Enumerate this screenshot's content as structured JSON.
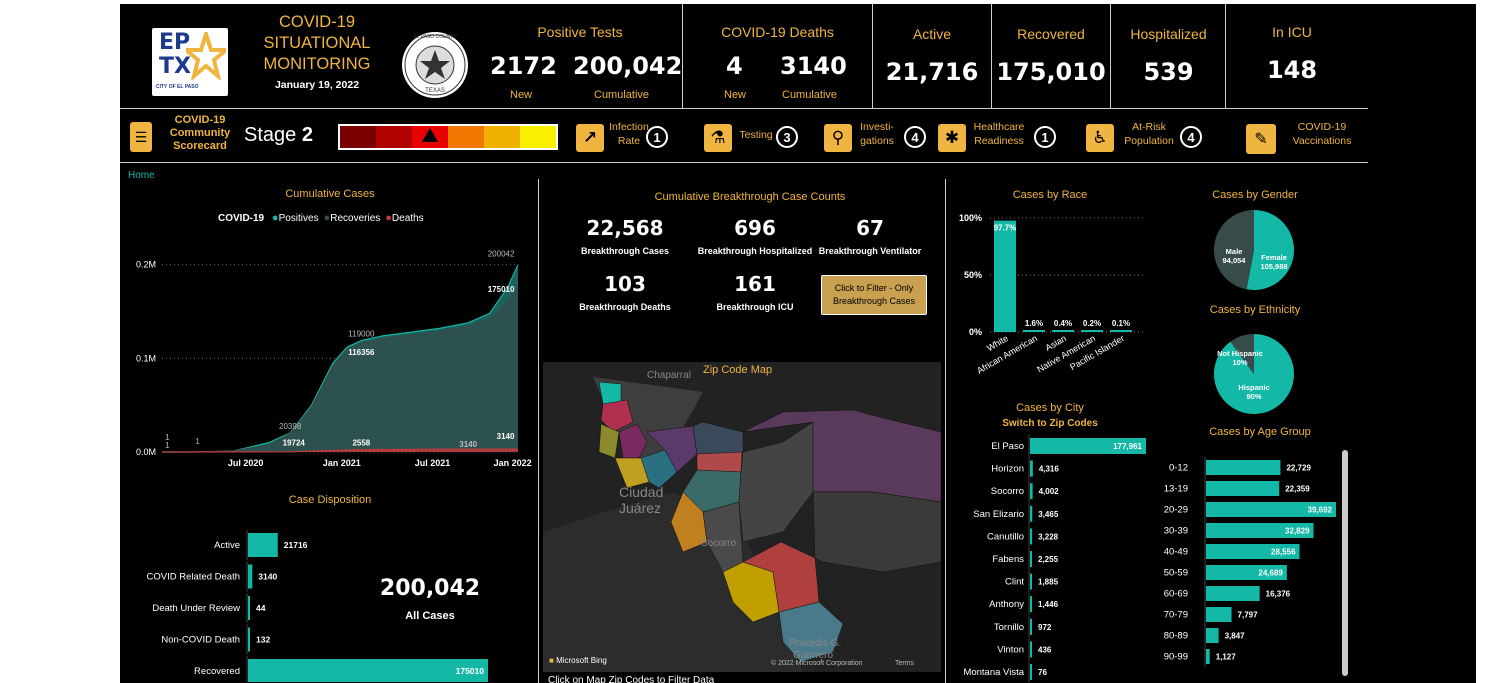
{
  "header": {
    "logo_ep": "EP",
    "logo_tx": "TX",
    "logo_sub": "CITY OF EL PASO",
    "title_line1": "COVID-19",
    "title_line2": "SITUATIONAL",
    "title_line3": "MONITORING",
    "date": "January 19, 2022",
    "seal_top": "EL PASO COUNTY",
    "seal_bottom": "TEXAS"
  },
  "kpis": {
    "positive_title": "Positive Tests",
    "positive_new": "2172",
    "positive_cum": "200,042",
    "new_label": "New",
    "cum_label": "Cumulative",
    "deaths_title": "COVID-19 Deaths",
    "deaths_new": "4",
    "deaths_cum": "3140",
    "active_title": "Active",
    "active_val": "21,716",
    "recovered_title": "Recovered",
    "recovered_val": "175,010",
    "hosp_title": "Hospitalized",
    "hosp_val": "539",
    "icu_title": "In ICU",
    "icu_val": "148"
  },
  "scorecard": {
    "label_line1": "COVID-19",
    "label_line2": "Community",
    "label_line3": "Scorecard",
    "stage_label": "Stage",
    "stage_num": "2",
    "items": [
      {
        "line1": "Infection",
        "line2": "Rate",
        "num": "1",
        "icon": "chart-icon"
      },
      {
        "line1": "Testing",
        "line2": "",
        "num": "3",
        "icon": "flask-icon"
      },
      {
        "line1": "Investi-",
        "line2": "gations",
        "num": "4",
        "icon": "magnifier-icon"
      },
      {
        "line1": "Healthcare",
        "line2": "Readiness",
        "num": "1",
        "icon": "medical-icon"
      },
      {
        "line1": "At-Risk",
        "line2": "Population",
        "num": "4",
        "icon": "wheelchair-icon"
      }
    ],
    "vacc_line1": "COVID-19",
    "vacc_line2": "Vaccinations",
    "level_colors": [
      "#7a0000",
      "#b00000",
      "#e80000",
      "#f07800",
      "#f0b000",
      "#f8f000"
    ]
  },
  "home_link": "Home",
  "cumulative": {
    "title": "Cumulative Cases",
    "legend_title": "COVID-19",
    "legend": [
      {
        "name": "Positives",
        "color": "#14b8a6"
      },
      {
        "name": "Recoveries",
        "color": "#374c4a"
      },
      {
        "name": "Deaths",
        "color": "#c0393b"
      }
    ]
  },
  "disposition": {
    "title": "Case Disposition",
    "total": "200,042",
    "total_label": "All Cases"
  },
  "breakthrough": {
    "title": "Cumulative Breakthrough Case Counts",
    "items": [
      {
        "value": "22,568",
        "label": "Breakthrough Cases"
      },
      {
        "value": "696",
        "label": "Breakthrough Hospitalized"
      },
      {
        "value": "67",
        "label": "Breakthrough Ventilator"
      },
      {
        "value": "103",
        "label": "Breakthrough Deaths"
      },
      {
        "value": "161",
        "label": "Breakthrough ICU"
      }
    ],
    "filter_line1": "Click to Filter - Only",
    "filter_line2": "Breakthrough Cases"
  },
  "map": {
    "title": "Zip Code Map",
    "chaparral": "Chaparral",
    "ciudad": "Ciudad",
    "juarez": "Juárez",
    "socorro": "Socorro",
    "praxedis1": "Praxedis G.",
    "praxedis2": "Guerrero",
    "bing": "Microsoft Bing",
    "copyright": "© 2022 Microsoft Corporation",
    "terms": "Terms",
    "footer": "Click on Map Zip Codes  to Filter Data"
  },
  "city": {
    "title": "Cases  by City",
    "switch": "Switch to Zip Codes"
  },
  "gender": {
    "title": "Cases by Gender"
  },
  "ethnicity": {
    "title": "Cases by Ethnicity"
  },
  "age_title": "Cases  by Age Group",
  "chart_data": [
    {
      "type": "area",
      "title": "Cumulative Cases",
      "x_ticks": [
        "Jul 2020",
        "Jan 2021",
        "Jul 2021",
        "Jan 2022"
      ],
      "y_ticks": [
        "0.0M",
        "0.1M",
        "0.2M"
      ],
      "ylim": [
        0,
        220000
      ],
      "series": [
        {
          "name": "Positives",
          "color": "#14b8a6",
          "points": [
            [
              0,
              1
            ],
            [
              0.08,
              20
            ],
            [
              0.2,
              1000
            ],
            [
              0.3,
              10000
            ],
            [
              0.36,
              20398
            ],
            [
              0.42,
              50000
            ],
            [
              0.48,
              95000
            ],
            [
              0.52,
              112000
            ],
            [
              0.56,
              119000
            ],
            [
              0.62,
              124000
            ],
            [
              0.7,
              128000
            ],
            [
              0.78,
              132000
            ],
            [
              0.86,
              138000
            ],
            [
              0.92,
              148000
            ],
            [
              0.97,
              175000
            ],
            [
              1,
              200042
            ]
          ]
        },
        {
          "name": "Recoveries",
          "color": "#374c4a",
          "points": [
            [
              0,
              1
            ],
            [
              0.08,
              15
            ],
            [
              0.2,
              800
            ],
            [
              0.3,
              8000
            ],
            [
              0.36,
              19724
            ],
            [
              0.42,
              48000
            ],
            [
              0.48,
              92000
            ],
            [
              0.52,
              110000
            ],
            [
              0.56,
              116356
            ],
            [
              0.62,
              121000
            ],
            [
              0.7,
              125000
            ],
            [
              0.78,
              129000
            ],
            [
              0.86,
              134000
            ],
            [
              0.92,
              142000
            ],
            [
              0.97,
              160000
            ],
            [
              1,
              175010
            ]
          ]
        },
        {
          "name": "Deaths",
          "color": "#c0393b",
          "points": [
            [
              0,
              1
            ],
            [
              0.36,
              200
            ],
            [
              0.56,
              2558
            ],
            [
              0.8,
              2900
            ],
            [
              1,
              3140
            ]
          ]
        }
      ],
      "annotations": [
        {
          "x": 0.015,
          "y": 1,
          "text": "1",
          "pos": "above-high"
        },
        {
          "x": 0.015,
          "y": 1,
          "text": "1",
          "pos": "above"
        },
        {
          "x": 0.1,
          "y": 1,
          "text": "1",
          "pos": "above-mid"
        },
        {
          "x": 0.36,
          "y": 20398,
          "text": "20398",
          "pos": "above"
        },
        {
          "x": 0.37,
          "y": 19724,
          "text": "19724",
          "pos": "below"
        },
        {
          "x": 0.56,
          "y": 119000,
          "text": "119000",
          "pos": "above"
        },
        {
          "x": 0.56,
          "y": 116356,
          "text": "116356",
          "pos": "below"
        },
        {
          "x": 0.56,
          "y": 2558,
          "text": "2558",
          "pos": "above"
        },
        {
          "x": 0.86,
          "y": 3140,
          "text": "3140",
          "pos": "below"
        },
        {
          "x": 0.99,
          "y": 200042,
          "text": "200042",
          "pos": "above"
        },
        {
          "x": 0.99,
          "y": 175010,
          "text": "175010",
          "pos": "bold"
        },
        {
          "x": 0.99,
          "y": 3140,
          "text": "3140",
          "pos": "bold"
        }
      ]
    },
    {
      "type": "bar",
      "orientation": "horizontal",
      "title": "Case Disposition",
      "categories": [
        "Active",
        "COVID Related Death",
        "Death Under Review",
        "Non-COVID Death",
        "Recovered"
      ],
      "values": [
        21716,
        3140,
        44,
        132,
        175010
      ],
      "labels": [
        "21716",
        "3140",
        "44",
        "132",
        "175010"
      ],
      "color": "#14b8a6",
      "max": 175010
    },
    {
      "type": "bar",
      "title": "Cases by Race",
      "categories": [
        "White",
        "African American",
        "Asian",
        "Native American",
        "Pacific Islander"
      ],
      "values": [
        97.7,
        1.6,
        0.4,
        0.2,
        0.1
      ],
      "labels": [
        "97.7%",
        "1.6%",
        "0.4%",
        "0.2%",
        "0.1%"
      ],
      "y_ticks": [
        "0%",
        "50%",
        "100%"
      ],
      "ylim": [
        0,
        100
      ],
      "color": "#14b8a6"
    },
    {
      "type": "bar",
      "orientation": "horizontal",
      "title": "Cases  by City",
      "categories": [
        "El Paso",
        "Horizon",
        "Socorro",
        "San Elizario",
        "Canutillo",
        "Fabens",
        "Clint",
        "Anthony",
        "Tornillo",
        "Vinton",
        "Montana Vista"
      ],
      "values": [
        177961,
        4316,
        4002,
        3465,
        3228,
        2255,
        1885,
        1446,
        972,
        436,
        76
      ],
      "labels": [
        "177,961",
        "4,316",
        "4,002",
        "3,465",
        "3,228",
        "2,255",
        "1,885",
        "1,446",
        "972",
        "436",
        "76"
      ],
      "color": "#14b8a6",
      "max": 177961
    },
    {
      "type": "pie",
      "title": "Cases by Gender",
      "slices": [
        {
          "name": "Female",
          "value": 105988,
          "label": "105,988",
          "color": "#14b8a6"
        },
        {
          "name": "Male",
          "value": 94054,
          "label": "94,054",
          "color": "#374c4a"
        }
      ]
    },
    {
      "type": "pie",
      "title": "Cases by Ethnicity",
      "slices": [
        {
          "name": "Hispanic",
          "value": 90,
          "label": "90%",
          "color": "#14b8a6"
        },
        {
          "name": "Not Hispanic",
          "value": 10,
          "label": "10%",
          "color": "#374c4a"
        }
      ]
    },
    {
      "type": "bar",
      "orientation": "horizontal",
      "title": "Cases  by Age Group",
      "categories": [
        "0-12",
        "13-19",
        "20-29",
        "30-39",
        "40-49",
        "50-59",
        "60-69",
        "70-79",
        "80-89",
        "90-99"
      ],
      "values": [
        22729,
        22359,
        39692,
        32829,
        28556,
        24689,
        16376,
        7797,
        3847,
        1127
      ],
      "labels": [
        "22,729",
        "22,359",
        "39,692",
        "32,829",
        "28,556",
        "24,689",
        "16,376",
        "7,797",
        "3,847",
        "1,127"
      ],
      "color": "#14b8a6",
      "max": 39692
    }
  ]
}
